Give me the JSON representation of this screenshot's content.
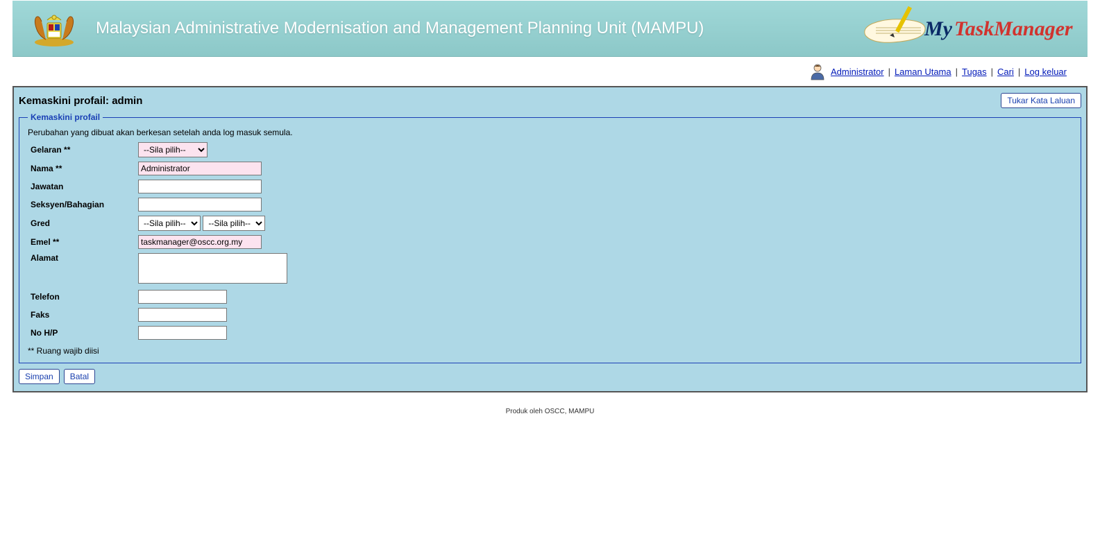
{
  "header": {
    "site_title": "Malaysian Administrative Modernisation and Management Planning Unit (MAMPU)",
    "logo_my": "My",
    "logo_task": "TaskManager"
  },
  "topbar": {
    "user_label": "Administrator",
    "home_label": "Laman Utama",
    "tasks_label": "Tugas",
    "search_label": "Cari",
    "logout_label": "Log keluar",
    "separator": "|"
  },
  "page": {
    "title": "Kemaskini profail: admin",
    "change_pw_label": "Tukar Kata Laluan"
  },
  "form": {
    "legend": "Kemaskini profail",
    "note": "Perubahan yang dibuat akan berkesan setelah anda log masuk semula.",
    "labels": {
      "gelaran": "Gelaran **",
      "nama": "Nama **",
      "jawatan": "Jawatan",
      "seksyen": "Seksyen/Bahagian",
      "gred": "Gred",
      "emel": "Emel **",
      "alamat": "Alamat",
      "telefon": "Telefon",
      "faks": "Faks",
      "nohp": "No H/P"
    },
    "values": {
      "gelaran": "--Sila pilih--",
      "nama": "Administrator",
      "jawatan": "",
      "seksyen": "",
      "gred1": "--Sila pilih--",
      "gred2": "--Sila pilih--",
      "emel": "taskmanager@oscc.org.my",
      "alamat": "",
      "telefon": "",
      "faks": "",
      "nohp": ""
    },
    "footnote": "** Ruang wajib diisi",
    "save_label": "Simpan",
    "cancel_label": "Batal"
  },
  "footer": {
    "text": "Produk oleh OSCC, MAMPU"
  }
}
